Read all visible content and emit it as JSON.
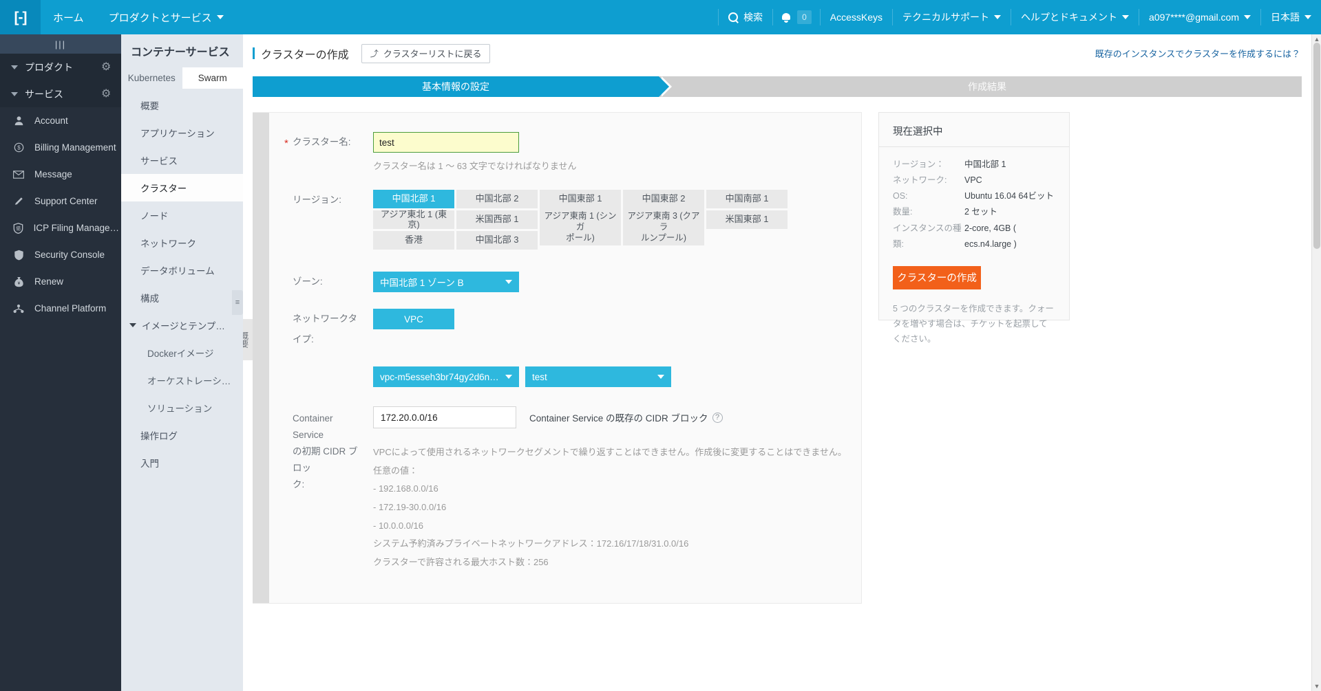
{
  "topnav": {
    "logo": "cloud-logo-icon",
    "left_items": [
      {
        "label": "ホーム",
        "caret": false,
        "name": "nav-home"
      },
      {
        "label": "プロダクトとサービス",
        "caret": true,
        "name": "nav-products-services"
      }
    ],
    "search_label": "検索",
    "notification_count": "0",
    "right_items": [
      {
        "label": "AccessKeys",
        "caret": false,
        "name": "nav-accesskeys"
      },
      {
        "label": "テクニカルサポート",
        "caret": true,
        "name": "nav-technical-support"
      },
      {
        "label": "ヘルプとドキュメント",
        "caret": true,
        "name": "nav-help-docs"
      },
      {
        "label": "a097****@gmail.com",
        "caret": true,
        "name": "nav-account-email"
      },
      {
        "label": "日本語",
        "caret": true,
        "name": "nav-language"
      }
    ]
  },
  "darkbar": {
    "handle": "|||",
    "groups": [
      {
        "label": "プロダクト",
        "name": "dark-group-products"
      },
      {
        "label": "サービス",
        "name": "dark-group-services"
      }
    ],
    "items": [
      {
        "label": "Account",
        "icon": "user-icon",
        "glyph": "὆4",
        "name": "sidebar-item-account"
      },
      {
        "label": "Billing Management",
        "icon": "dollar-icon",
        "glyph": "$",
        "name": "sidebar-item-billing-management"
      },
      {
        "label": "Message",
        "icon": "envelope-icon",
        "glyph": "✉",
        "name": "sidebar-item-message"
      },
      {
        "label": "Support Center",
        "icon": "pencil-icon",
        "glyph": "✎",
        "name": "sidebar-item-support-center"
      },
      {
        "label": "ICP Filing Managem…",
        "icon": "shield-icon",
        "glyph": "⛊",
        "name": "sidebar-item-icp-filing-management"
      },
      {
        "label": "Security Console",
        "icon": "shield-solid-icon",
        "glyph": "⛊",
        "name": "sidebar-item-security-console"
      },
      {
        "label": "Renew",
        "icon": "money-bag-icon",
        "glyph": "¥",
        "name": "sidebar-item-renew"
      },
      {
        "label": "Channel Platform",
        "icon": "network-icon",
        "glyph": "⑂",
        "name": "sidebar-item-channel-platform"
      }
    ]
  },
  "subnav": {
    "title": "コンテナーサービス",
    "tabs": [
      {
        "label": "Kubernetes",
        "active": false,
        "name": "tab-kubernetes"
      },
      {
        "label": "Swarm",
        "active": true,
        "name": "tab-swarm"
      }
    ],
    "items": [
      {
        "label": "概要",
        "type": "item",
        "active": false,
        "name": "subnav-item-overview"
      },
      {
        "label": "アプリケーション",
        "type": "item",
        "active": false,
        "name": "subnav-item-applications"
      },
      {
        "label": "サービス",
        "type": "item",
        "active": false,
        "name": "subnav-item-services"
      },
      {
        "label": "クラスター",
        "type": "item",
        "active": true,
        "name": "subnav-item-clusters"
      },
      {
        "label": "ノード",
        "type": "item",
        "active": false,
        "name": "subnav-item-nodes"
      },
      {
        "label": "ネットワーク",
        "type": "item",
        "active": false,
        "name": "subnav-item-networks"
      },
      {
        "label": "データボリューム",
        "type": "item",
        "active": false,
        "name": "subnav-item-data-volumes"
      },
      {
        "label": "構成",
        "type": "item",
        "active": false,
        "name": "subnav-item-configurations"
      },
      {
        "label": "イメージとテンプレート",
        "type": "group",
        "active": false,
        "name": "subnav-group-images-templates"
      },
      {
        "label": "Dockerイメージ",
        "type": "sub",
        "active": false,
        "name": "subnav-item-docker-images"
      },
      {
        "label": "オーケストレーショ…",
        "type": "sub",
        "active": false,
        "name": "subnav-item-orchestration-templates"
      },
      {
        "label": "ソリューション",
        "type": "sub",
        "active": false,
        "name": "subnav-item-solutions"
      },
      {
        "label": "操作ログ",
        "type": "item",
        "active": false,
        "name": "subnav-item-operation-logs"
      },
      {
        "label": "入門",
        "type": "item",
        "active": false,
        "name": "subnav-item-getting-started"
      }
    ],
    "collapse_glyph": "≡"
  },
  "page": {
    "title": "クラスターの作成",
    "back_button": "クラスターリストに戻る",
    "back_icon": "⤴",
    "existing_instance_link": "既存のインスタンスでクラスターを作成するには？",
    "steps": [
      {
        "label": "基本情報の設定",
        "active": true,
        "name": "step-basic-info"
      },
      {
        "label": "作成結果",
        "active": false,
        "name": "step-creation-result"
      }
    ],
    "vertical_tab": "概要"
  },
  "form": {
    "cluster_name": {
      "label": "クラスター名:",
      "required_mark": "*",
      "value": "test",
      "placeholder": "",
      "hint": "クラスター名は 1 ～ 63 文字でなければなりません"
    },
    "region": {
      "label": "リージョン:",
      "rows": [
        [
          {
            "label": "中国北部 1",
            "active": true,
            "name": "region-china-north-1"
          },
          {
            "label": "中国北部 2",
            "active": false,
            "name": "region-china-north-2"
          },
          {
            "label": "中国東部 1",
            "active": false,
            "name": "region-china-east-1"
          },
          {
            "label": "中国東部 2",
            "active": false,
            "name": "region-china-east-2"
          },
          {
            "label": "中国南部 1",
            "active": false,
            "name": "region-china-south-1"
          }
        ],
        [
          {
            "label": "アジア東北 1 (東京)",
            "active": false,
            "name": "region-asia-northeast-1-tokyo"
          },
          {
            "label": "米国西部 1",
            "active": false,
            "name": "region-us-west-1"
          },
          {
            "label": "アジア東南 1 (シンガポール)",
            "active": false,
            "name": "region-asia-southeast-1-singapore"
          },
          {
            "label": "アジア東南 3 (クアラルンプール)",
            "active": false,
            "name": "region-asia-southeast-3-kuala-lumpur"
          },
          {
            "label": "米国東部 1",
            "active": false,
            "name": "region-us-east-1"
          }
        ],
        [
          {
            "label": "香港",
            "active": false,
            "name": "region-hong-kong"
          },
          {
            "label": "中国北部 3",
            "active": false,
            "name": "region-china-north-3"
          }
        ]
      ],
      "double_cells": [
        {
          "line1": "アジア東南 1 (シンガ",
          "line2": "ポール)",
          "name": "region-asia-southeast-1-singapore-cell"
        },
        {
          "line1": "アジア東南 3 (クアラ",
          "line2": "ルンプール)",
          "name": "region-asia-southeast-3-kuala-lumpur-cell"
        }
      ]
    },
    "zone": {
      "label": "ゾーン:",
      "value": "中国北部 1 ゾーン B"
    },
    "network_type": {
      "label": "ネットワークタイプ:",
      "value": "VPC"
    },
    "vpc_select": {
      "value": "vpc-m5esseh3br74gy2d6n8n…",
      "name": "vpc-select"
    },
    "vswitch_select": {
      "value": "test",
      "name": "vswitch-select"
    },
    "cidr": {
      "label_lines": [
        "Container Service",
        "の初期 CIDR ブロッ",
        "ク:"
      ],
      "value": "172.20.0.0/16",
      "note": "Container Service の既存の CIDR ブロック",
      "help_glyph": "?"
    },
    "description_lines": [
      "VPCによって使用されるネットワークセグメントで繰り返すことはできません。作成後に変更することはできません。",
      "任意の値：",
      "- 192.168.0.0/16",
      "- 172.19-30.0.0/16",
      "- 10.0.0.0/16",
      "システム予約済みプライベートネットワークアドレス：172.16/17/18/31.0.0/16",
      "クラスターで許容される最大ホスト数：256"
    ]
  },
  "summary": {
    "title": "現在選択中",
    "rows": [
      {
        "key": "リージョン：",
        "value": "中国北部 1",
        "name": "summary-region"
      },
      {
        "key": "ネットワーク:",
        "value": "VPC",
        "name": "summary-network"
      },
      {
        "key": "OS:",
        "value": "Ubuntu 16.04 64ビット",
        "name": "summary-os"
      },
      {
        "key": "数量:",
        "value": "2 セット",
        "name": "summary-quantity"
      },
      {
        "key": "インスタンスの種",
        "value": "2-core, 4GB (",
        "name": "summary-instance-type-1"
      },
      {
        "key": "類:",
        "value": "ecs.n4.large )",
        "name": "summary-instance-type-2"
      }
    ],
    "create_button": "クラスターの作成",
    "quota_note": "5 つのクラスターを作成できます。クォータを増やす場合は、チケットを起票してください。"
  },
  "colors": {
    "brand_blue": "#0e9ed0",
    "accent_cyan": "#2eb8de",
    "orange": "#f2601a",
    "dark_sidebar": "#262f3b",
    "subnav_bg": "#e3e8ee",
    "link_blue": "#1763a0",
    "input_highlight": "#fcfccd",
    "input_border_green": "#4b9c3c"
  }
}
